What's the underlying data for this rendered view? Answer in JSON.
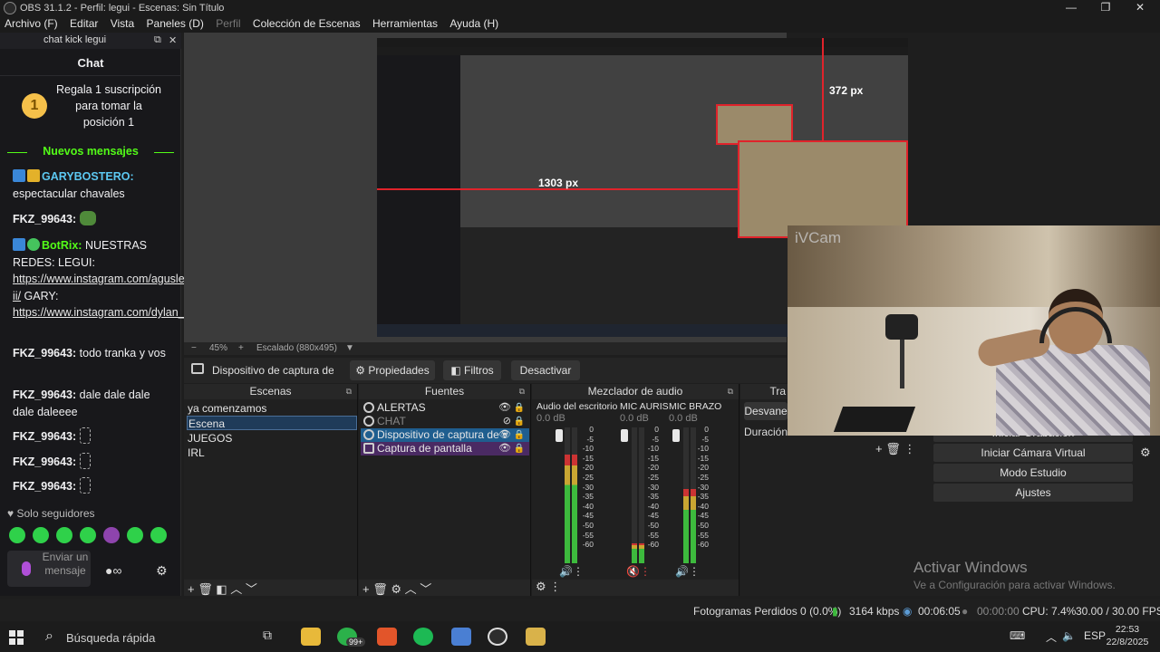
{
  "window": {
    "title": "OBS 31.1.2 - Perfil: legui - Escenas: Sin Título",
    "controls": [
      "—",
      "❐",
      "✕"
    ]
  },
  "menu": [
    "Archivo (F)",
    "Editar",
    "Vista",
    "Paneles (D)",
    "Perfil",
    "Colección de Escenas",
    "Herramientas",
    "Ayuda (H)"
  ],
  "chat_dock": {
    "dock_title": "chat kick legui",
    "header": "Chat",
    "gift": {
      "coin": "1",
      "text": "Regala 1 suscripción para tomar la posición 1"
    },
    "new_messages": "Nuevos mensajes",
    "messages": [
      {
        "user": "GARYBOSTERO:",
        "user_color": "#5cc8f2",
        "text": "espectacular chavales"
      },
      {
        "user": "FKZ_99643:",
        "user_color": "#ffffff",
        "text": ""
      },
      {
        "user": "BotRix:",
        "user_color": "#53fc18",
        "text": "NUESTRAS REDES: LEGUI:",
        "link1": "https://www.instagram.com/aguslegui ii/",
        "mid": "GARY:",
        "link2": "https://www.instagram.com/dylan_canosa/"
      },
      {
        "user": "FKZ_99643:",
        "user_color": "#ffffff",
        "text": "todo tranka y vos"
      },
      {
        "user": "FKZ_99643:",
        "user_color": "#ffffff",
        "text": "dale dale dale dale daleeee"
      },
      {
        "user": "FKZ_99643:",
        "user_color": "#ffffff",
        "text": ""
      },
      {
        "user": "FKZ_99643:",
        "user_color": "#ffffff",
        "text": ""
      },
      {
        "user": "FKZ_99643:",
        "user_color": "#ffffff",
        "text": ""
      }
    ],
    "followers_only": "Solo seguidores",
    "input_placeholder": "Enviar un mensaje"
  },
  "preview": {
    "measure_h": "1303 px",
    "measure_v": "372 px",
    "zoom": "45%",
    "scaled": "Escalado (880x495)"
  },
  "source_toolbar": {
    "source_name": "Dispositivo de captura de v",
    "properties": "Propiedades",
    "filters": "Filtros",
    "deactivate": "Desactivar"
  },
  "scenes": {
    "title": "Escenas",
    "items": [
      "ya comenzamos",
      "Escena",
      "JUEGOS",
      "IRL"
    ],
    "selected": 1
  },
  "sources": {
    "title": "Fuentes",
    "items": [
      "ALERTAS",
      "CHAT",
      "Dispositivo de captura de v",
      "Captura de pantalla"
    ]
  },
  "mixer": {
    "title": "Mezclador de audio",
    "channels": [
      {
        "name": "Audio del escritorio",
        "db": "0.0 dB",
        "level": 0.8
      },
      {
        "name": "MIC AURIS",
        "db": "0.0 dB",
        "level": 0.15
      },
      {
        "name": "MIC BRAZO",
        "db": "0.0 dB",
        "level": 0.55
      }
    ],
    "scale": [
      "0",
      "-5",
      "-10",
      "-15",
      "-20",
      "-25",
      "-30",
      "-35",
      "-40",
      "-45",
      "-50",
      "-55",
      "-60"
    ]
  },
  "transitions": {
    "title": "Tra",
    "fade": "Desvane",
    "duration": "Duración"
  },
  "controls": {
    "start_recording": "Iniciar Grabación",
    "virtual_cam": "Iniciar Cámara Virtual",
    "studio_mode": "Modo Estudio",
    "settings": "Ajustes"
  },
  "webcam": {
    "label": "iVCam"
  },
  "watermark": {
    "line1": "Activar Windows",
    "line2": "Ve a Configuración para activar Windows."
  },
  "status": {
    "dropped": "Fotogramas Perdidos 0 (0.0%)",
    "kbps": "3164 kbps",
    "stream_time": "00:06:05",
    "rec_time": "00:00:00",
    "cpu": "CPU: 7.4%",
    "fps": "30.00 / 30.00 FPS"
  },
  "taskbar": {
    "search": "Búsqueda rápida",
    "badge": "99+",
    "lang": "ESP",
    "time": "22:53",
    "date": "22/8/2025"
  },
  "colors": {
    "accent_green": "#53fc18",
    "scene_select": "#1f3b59",
    "source_blue": "#1f5e8f",
    "source_purple": "#4a2a63",
    "red_guide": "#e0232b"
  }
}
